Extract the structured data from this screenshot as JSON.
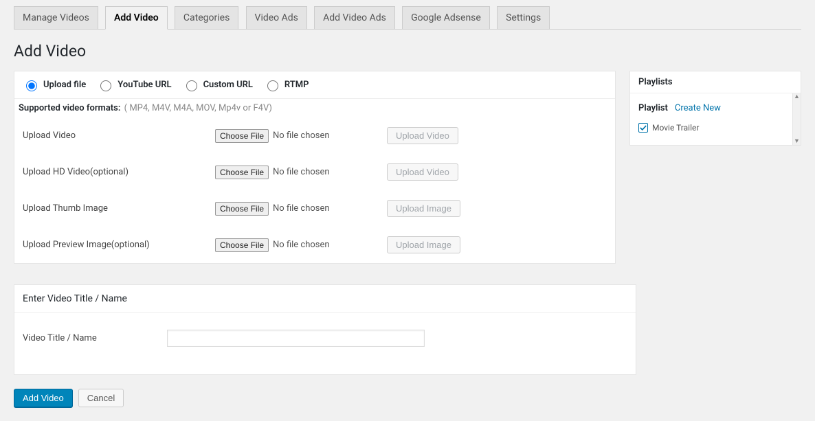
{
  "tabs": {
    "items": [
      {
        "label": "Manage Videos",
        "active": false
      },
      {
        "label": "Add Video",
        "active": true
      },
      {
        "label": "Categories",
        "active": false
      },
      {
        "label": "Video Ads",
        "active": false
      },
      {
        "label": "Add Video Ads",
        "active": false
      },
      {
        "label": "Google Adsense",
        "active": false
      },
      {
        "label": "Settings",
        "active": false
      }
    ]
  },
  "page_title": "Add Video",
  "source_options": {
    "upload_file": "Upload file",
    "youtube_url": "YouTube URL",
    "custom_url": "Custom URL",
    "rtmp": "RTMP",
    "selected": "upload_file"
  },
  "formats": {
    "lead": "Supported video formats:",
    "list": "( MP4, M4V, M4A, MOV, Mp4v or F4V)"
  },
  "upload_rows": {
    "choose_label": "Choose File",
    "no_file": "No file chosen",
    "rows": [
      {
        "label": "Upload Video",
        "action": "Upload Video"
      },
      {
        "label": "Upload HD Video(optional)",
        "action": "Upload Video"
      },
      {
        "label": "Upload Thumb Image",
        "action": "Upload Image"
      },
      {
        "label": "Upload Preview Image(optional)",
        "action": "Upload Image"
      }
    ]
  },
  "title_panel": {
    "header": "Enter Video Title / Name",
    "field_label": "Video Title / Name",
    "value": ""
  },
  "actions": {
    "primary": "Add Video",
    "secondary": "Cancel"
  },
  "sidebar": {
    "header": "Playlists",
    "playlist_label": "Playlist",
    "create_new": "Create New",
    "items": [
      {
        "label": "Movie Trailer",
        "checked": true
      }
    ]
  }
}
